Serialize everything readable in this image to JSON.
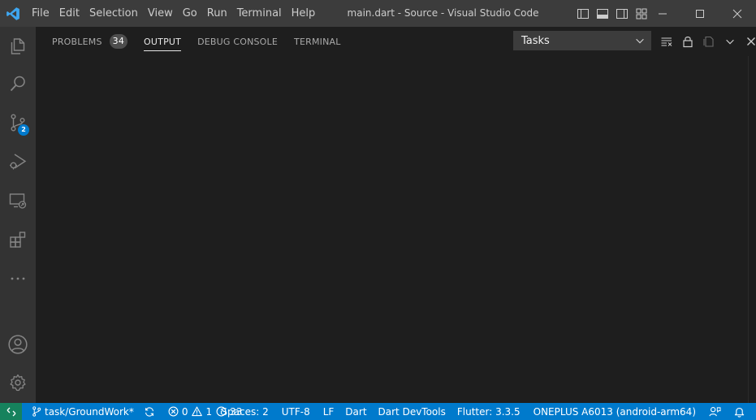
{
  "titlebar": {
    "menu": [
      "File",
      "Edit",
      "Selection",
      "View",
      "Go",
      "Run",
      "Terminal",
      "Help"
    ],
    "title": "main.dart - Source - Visual Studio Code"
  },
  "activitybar": {
    "items": [
      {
        "name": "explorer-icon"
      },
      {
        "name": "search-icon"
      },
      {
        "name": "source-control-icon",
        "badge": "2"
      },
      {
        "name": "run-debug-icon"
      },
      {
        "name": "remote-explorer-icon"
      },
      {
        "name": "extensions-icon"
      },
      {
        "name": "more-icon"
      }
    ],
    "bottom": [
      {
        "name": "account-icon"
      },
      {
        "name": "settings-gear-icon"
      }
    ]
  },
  "panel": {
    "tabs": [
      {
        "label": "PROBLEMS",
        "badge": "34",
        "active": false
      },
      {
        "label": "OUTPUT",
        "active": true
      },
      {
        "label": "DEBUG CONSOLE",
        "active": false
      },
      {
        "label": "TERMINAL",
        "active": false
      }
    ],
    "output_channel": "Tasks"
  },
  "statusbar": {
    "branch": "task/GroundWork*",
    "errors": "0",
    "warnings": "1",
    "infos": "33",
    "spaces": "Spaces: 2",
    "encoding": "UTF-8",
    "eol": "LF",
    "language": "Dart",
    "devtools": "Dart DevTools",
    "flutter": "Flutter: 3.3.5",
    "device": "ONEPLUS A6013 (android-arm64)"
  },
  "colors": {
    "accent": "#007acc",
    "remote": "#16825d",
    "titlebar": "#3c3c3c",
    "activitybar": "#333333",
    "editor": "#1e1e1e"
  }
}
